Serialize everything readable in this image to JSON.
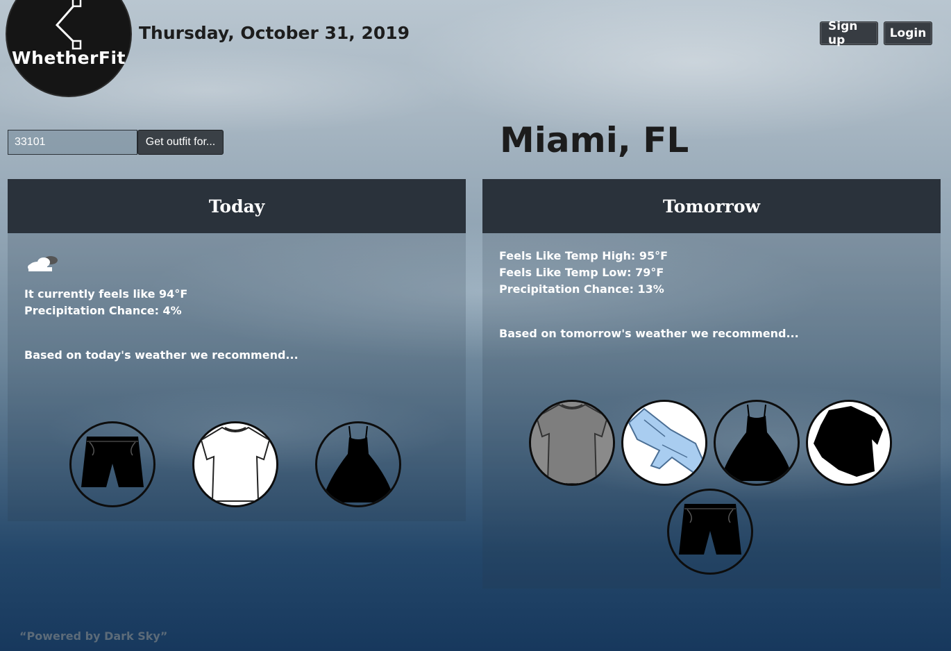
{
  "brand": {
    "name": "WhetherFit"
  },
  "header": {
    "date": "Thursday, October 31, 2019",
    "signup_label": "Sign up",
    "login_label": "Login"
  },
  "search": {
    "value": "33101",
    "button_label": "Get outfit for..."
  },
  "location": {
    "city": "Miami, FL"
  },
  "today": {
    "title": "Today",
    "weather_icon": "partly-cloudy-night-icon",
    "feels_like": "It currently feels like 94°F",
    "precipitation": "Precipitation Chance: 4%",
    "recommend_text": "Based on today's weather we recommend...",
    "items": [
      "shorts",
      "white-t-shirt",
      "black-dress"
    ]
  },
  "tomorrow": {
    "title": "Tomorrow",
    "feels_high": "Feels Like Temp High: 95°F",
    "feels_low": "Feels Like Temp Low: 79°F",
    "precipitation": "Precipitation Chance: 13%",
    "recommend_text": "Based on tomorrow's weather we recommend...",
    "items": [
      "gray-t-shirt",
      "jeans",
      "black-dress",
      "sweater",
      "shorts"
    ]
  },
  "footer": {
    "credit": "“Powered by Dark Sky”"
  },
  "colors": {
    "panel_header": "#2a323b",
    "button": "#373c42",
    "text_dark": "#1d1d1d"
  }
}
